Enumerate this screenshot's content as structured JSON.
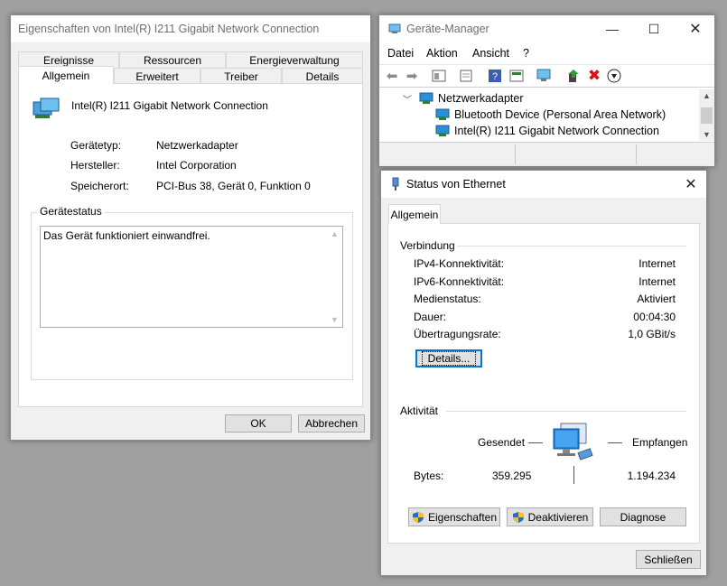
{
  "props": {
    "title": "Eigenschaften von Intel(R) I211 Gigabit Network Connection",
    "tabs_row1": [
      "Ereignisse",
      "Ressourcen",
      "Energieverwaltung"
    ],
    "tabs_row2": [
      "Allgemein",
      "Erweitert",
      "Treiber",
      "Details"
    ],
    "device_name": "Intel(R) I211 Gigabit Network Connection",
    "fields": [
      {
        "label": "Gerätetyp:",
        "value": "Netzwerkadapter"
      },
      {
        "label": "Hersteller:",
        "value": "Intel Corporation"
      },
      {
        "label": "Speicherort:",
        "value": "PCI-Bus 38, Gerät 0, Funktion 0"
      }
    ],
    "status_group": "Gerätestatus",
    "status_text": "Das Gerät funktioniert einwandfrei.",
    "ok": "OK",
    "cancel": "Abbrechen"
  },
  "devmgr": {
    "title": "Geräte-Manager",
    "menu": [
      "Datei",
      "Aktion",
      "Ansicht",
      "?"
    ],
    "tree": [
      {
        "label": "Netzwerkadapter",
        "level": 0
      },
      {
        "label": "Bluetooth Device (Personal Area Network)",
        "level": 1
      },
      {
        "label": "Intel(R) I211 Gigabit Network Connection",
        "level": 1
      }
    ]
  },
  "status": {
    "title": "Status von Ethernet",
    "tab": "Allgemein",
    "connection_header": "Verbindung",
    "rows": [
      {
        "label": "IPv4-Konnektivität:",
        "value": "Internet"
      },
      {
        "label": "IPv6-Konnektivität:",
        "value": "Internet"
      },
      {
        "label": "Medienstatus:",
        "value": "Aktiviert"
      },
      {
        "label": "Dauer:",
        "value": "00:04:30"
      },
      {
        "label": "Übertragungsrate:",
        "value": "1,0 GBit/s"
      }
    ],
    "details_button": "Details...",
    "activity_header": "Aktivität",
    "sent": "Gesendet",
    "received": "Empfangen",
    "bytes_label": "Bytes:",
    "bytes_sent": "359.295",
    "bytes_received": "1.194.234",
    "btn_properties": "Eigenschaften",
    "btn_disable": "Deaktivieren",
    "btn_diagnose": "Diagnose",
    "btn_close": "Schließen"
  },
  "colors": {
    "accent": "#0078d7",
    "error_red": "#d4141b",
    "monitor_blue": "#1e88e5"
  }
}
